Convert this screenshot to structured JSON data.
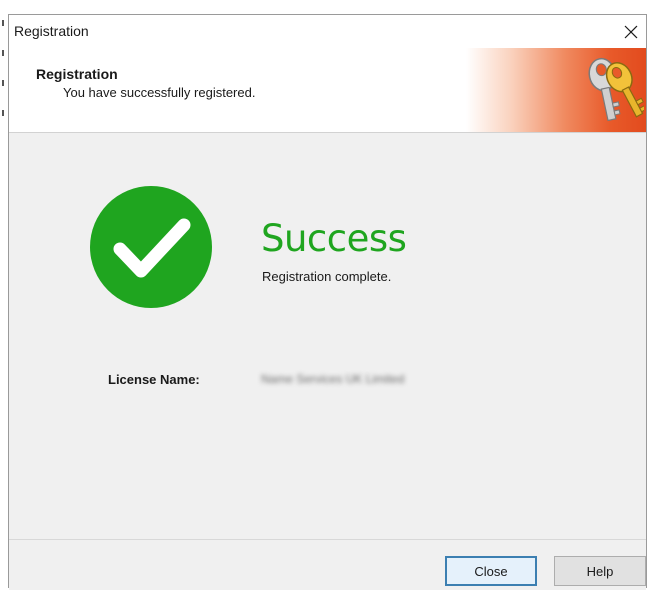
{
  "window": {
    "title": "Registration"
  },
  "header": {
    "title": "Registration",
    "subtitle": "You have successfully registered.",
    "icon": "keys-icon"
  },
  "main": {
    "status_icon": "checkmark-circle-icon",
    "heading": "Success",
    "message": "Registration complete.",
    "license_label": "License Name:",
    "license_value": "Name Services UK Limited"
  },
  "footer": {
    "close_label": "Close",
    "help_label": "Help"
  },
  "colors": {
    "success_green": "#1fa51f",
    "banner_orange": "#e24b1e",
    "default_button_border": "#3c7fb1"
  }
}
